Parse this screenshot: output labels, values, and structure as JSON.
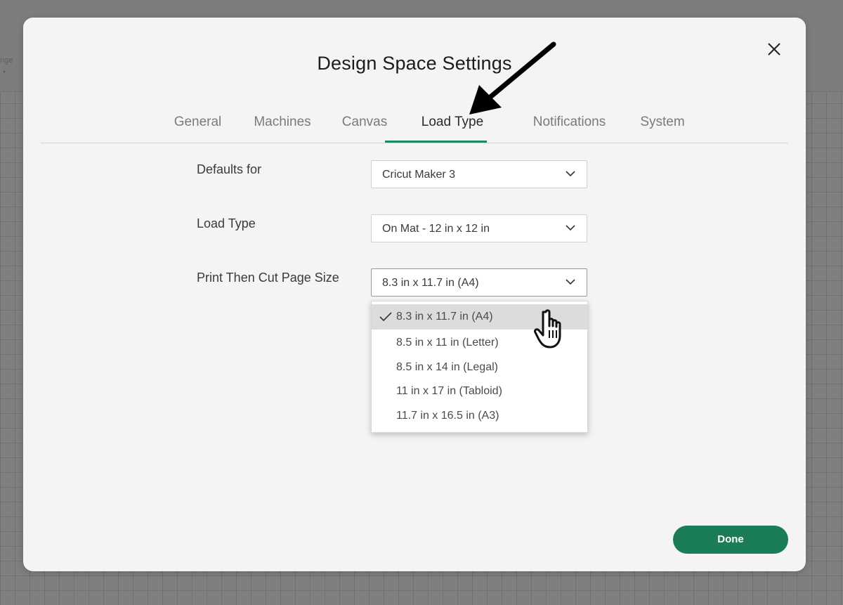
{
  "background": {
    "toolbar_label": "nge",
    "toolbar_caret": "▾"
  },
  "dialog": {
    "title": "Design Space Settings",
    "close_icon": "close-icon"
  },
  "tabs": [
    {
      "label": "General",
      "active": false
    },
    {
      "label": "Machines",
      "active": false
    },
    {
      "label": "Canvas",
      "active": false
    },
    {
      "label": "Load Type",
      "active": true
    },
    {
      "label": "Notifications",
      "active": false
    },
    {
      "label": "System",
      "active": false
    }
  ],
  "settings": {
    "defaults_for": {
      "label": "Defaults for",
      "value": "Cricut Maker 3"
    },
    "load_type": {
      "label": "Load Type",
      "value": "On Mat - 12 in x 12 in"
    },
    "page_size": {
      "label": "Print Then Cut Page Size",
      "value": "8.3 in x 11.7 in (A4)",
      "options": [
        {
          "label": "8.3 in x 11.7 in (A4)",
          "selected": true
        },
        {
          "label": "8.5 in x 11 in (Letter)",
          "selected": false
        },
        {
          "label": "8.5 in x 14 in (Legal)",
          "selected": false
        },
        {
          "label": "11 in x 17 in (Tabloid)",
          "selected": false
        },
        {
          "label": "11.7 in x 16.5 in (A3)",
          "selected": false
        }
      ]
    }
  },
  "footer": {
    "done_label": "Done"
  },
  "colors": {
    "accent": "#1b7d57",
    "tab_underline": "#1f8a5d",
    "dialog_bg": "#f4f4f4"
  }
}
